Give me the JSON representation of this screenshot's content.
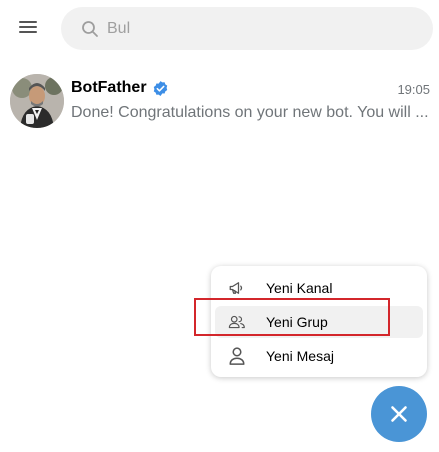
{
  "header": {
    "menu_icon": "hamburger-icon",
    "search": {
      "placeholder": "Bul",
      "value": "",
      "icon": "search-icon"
    }
  },
  "chats": [
    {
      "name": "BotFather",
      "verified": true,
      "time": "19:05",
      "preview": "Done! Congratulations on your new bot. You will ..."
    }
  ],
  "new_menu": {
    "items": [
      {
        "label": "Yeni Kanal",
        "icon": "megaphone-icon"
      },
      {
        "label": "Yeni Grup",
        "icon": "group-icon"
      },
      {
        "label": "Yeni Mesaj",
        "icon": "person-icon"
      }
    ]
  },
  "fab": {
    "icon": "close-icon"
  },
  "colors": {
    "accent": "#4a95d6",
    "verified": "#3d8ee6",
    "highlight": "#d3262b",
    "muted_text": "#707579",
    "search_bg": "#f1f1f1"
  }
}
